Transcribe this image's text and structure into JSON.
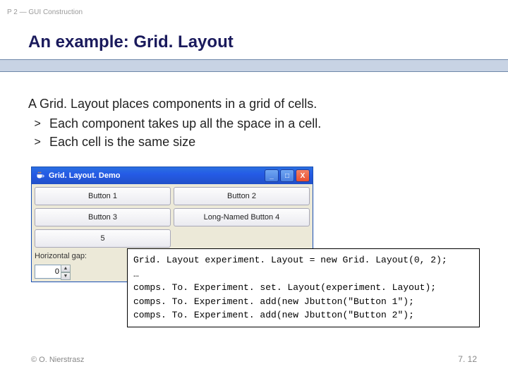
{
  "breadcrumb": "P 2 — GUI Construction",
  "title": "An example: Grid. Layout",
  "body": {
    "lead": "A Grid. Layout places components in a grid of cells.",
    "bullet_marker": ">",
    "items": [
      "Each component takes up all the space in a cell.",
      "Each cell is the same size"
    ]
  },
  "demo": {
    "window_title": "Grid. Layout. Demo",
    "buttons": [
      "Button 1",
      "Button 2",
      "Button 3",
      "Long-Named Button 4",
      "5"
    ],
    "hgap_label": "Horizontal gap:",
    "hgap_value": "0",
    "icon_min": "_",
    "icon_max": "□",
    "icon_close": "X"
  },
  "code": {
    "lines": [
      "Grid. Layout experiment. Layout = new Grid. Layout(0, 2);",
      "…",
      "comps. To. Experiment. set. Layout(experiment. Layout);",
      "comps. To. Experiment. add(new Jbutton(\"Button 1\");",
      "comps. To. Experiment. add(new Jbutton(\"Button 2\");"
    ]
  },
  "footer": {
    "left": "© O. Nierstrasz",
    "right": "7. 12"
  }
}
